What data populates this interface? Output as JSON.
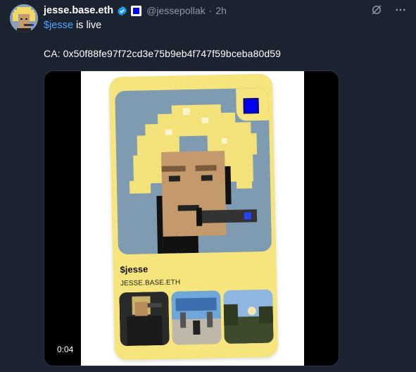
{
  "header": {
    "display_name": "jesse.base.eth",
    "handle": "@jessepollak",
    "separator": "·",
    "time": "2h"
  },
  "body": {
    "cashtag": "$jesse",
    "line1_rest": " is live",
    "line2": "CA: 0x50f88fe97f72cd3e75b9eb4f747f59bceba80d59"
  },
  "card": {
    "name": "$jesse",
    "subtitle": "JESSE.BASE.ETH"
  },
  "media": {
    "duration": "0:04"
  },
  "icons": {
    "verified": "verified-check-icon",
    "badge": "blue-square-badge-icon",
    "grok": "grok-icon",
    "more": "more-options-icon"
  },
  "colors": {
    "background": "#1c2330",
    "link": "#4aa3ff",
    "muted": "#8b98a9",
    "card_yellow": "#f6e47c",
    "badge_blue": "#0000ff"
  }
}
